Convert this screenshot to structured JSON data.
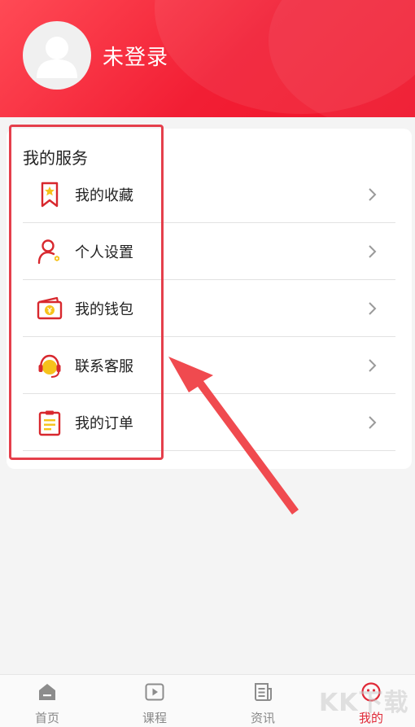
{
  "header": {
    "login_status": "未登录"
  },
  "services": {
    "title": "我的服务",
    "items": [
      {
        "label": "我的收藏",
        "icon": "bookmark-star-icon"
      },
      {
        "label": "个人设置",
        "icon": "user-settings-icon"
      },
      {
        "label": "我的钱包",
        "icon": "wallet-icon"
      },
      {
        "label": "联系客服",
        "icon": "headset-icon"
      },
      {
        "label": "我的订单",
        "icon": "clipboard-icon"
      }
    ]
  },
  "tabbar": {
    "tabs": [
      {
        "label": "首页",
        "icon": "home-icon"
      },
      {
        "label": "课程",
        "icon": "play-icon"
      },
      {
        "label": "资讯",
        "icon": "news-icon"
      },
      {
        "label": "我的",
        "icon": "profile-icon",
        "active": true
      }
    ]
  },
  "colors": {
    "brand": "#f21e34",
    "highlight": "#e53f4b",
    "icon_red": "#d8282e",
    "icon_yellow": "#f6c21b"
  },
  "watermark": "KK下载"
}
